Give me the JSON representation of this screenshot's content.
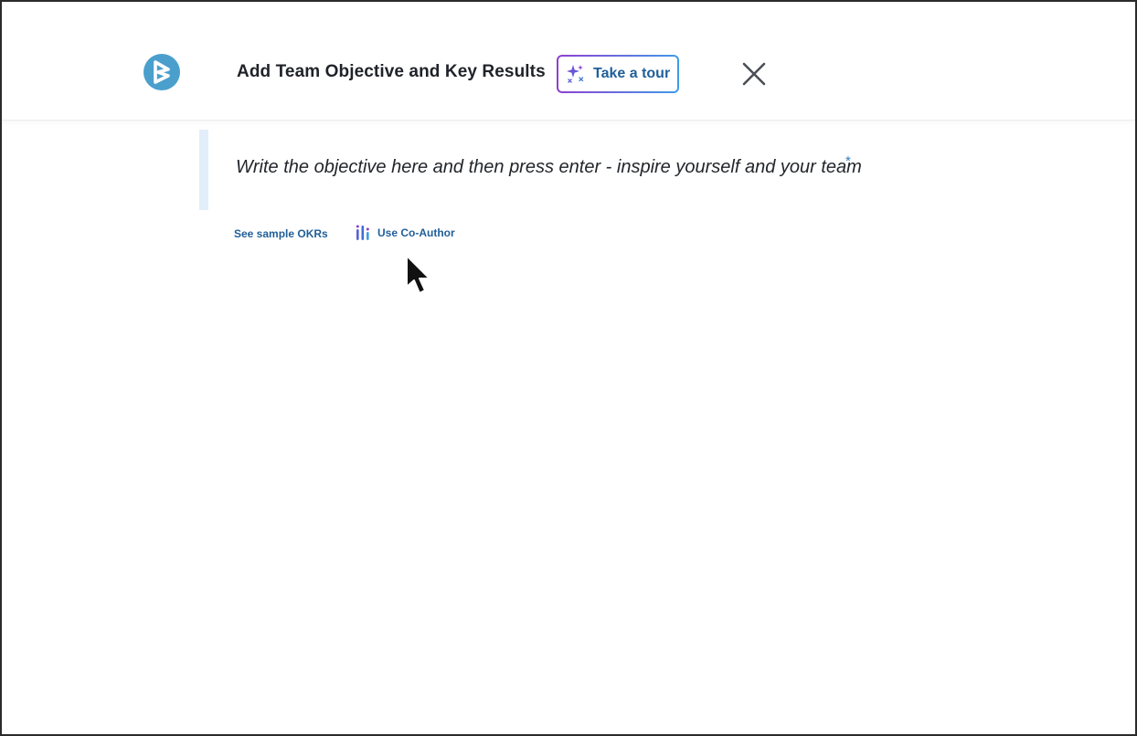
{
  "header": {
    "title": "Add Team Objective and Key Results",
    "logo_icon": "brand-logo-icon",
    "tour_button_label": "Take a tour",
    "tour_icon": "sparkle-icon",
    "close_icon": "close-icon"
  },
  "objective": {
    "placeholder": "Write the objective here and then press enter - inspire yourself and your team",
    "required_mark": "*"
  },
  "links": {
    "sample_okrs": "See sample OKRs",
    "co_author": "Use Co-Author",
    "co_author_icon": "co-author-icon"
  },
  "colors": {
    "brand": "#4a9fcd",
    "link": "#1f5f99",
    "gradient_start": "#8e3fd1",
    "gradient_end": "#3f9be8",
    "objective_bar": "#e2eef9"
  }
}
